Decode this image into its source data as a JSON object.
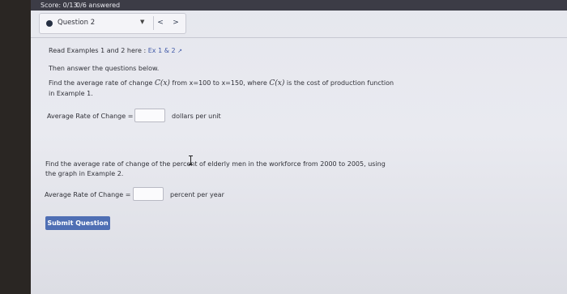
{
  "header": {
    "score": "Score: 0/13",
    "answered": "0/6 answered"
  },
  "question_nav": {
    "label": "Question 2",
    "dropdown_icon": "▼",
    "prev_icon": "<",
    "next_icon": ">"
  },
  "intro": {
    "read_prefix": "Read Examples 1 and 2 here : ",
    "link_text": "Ex 1 & 2",
    "then": "Then answer the questions below."
  },
  "q1": {
    "text_before": "Find the average rate of change ",
    "func": "C(x)",
    "text_mid": " from x=100 to x=150, where ",
    "func2": "C(x)",
    "text_after": " is the cost of production function",
    "line2": "in Example 1.",
    "answer_label": "Average Rate of Change =",
    "answer_value": "",
    "unit": "dollars per unit"
  },
  "q2": {
    "line1": "Find the average rate of change of the percent of elderly men in the workforce from 2000 to 2005, using",
    "line2": "the graph in Example 2.",
    "answer_label": "Average Rate of Change =",
    "answer_value": "",
    "unit": "percent per year"
  },
  "submit_label": "Submit Question"
}
